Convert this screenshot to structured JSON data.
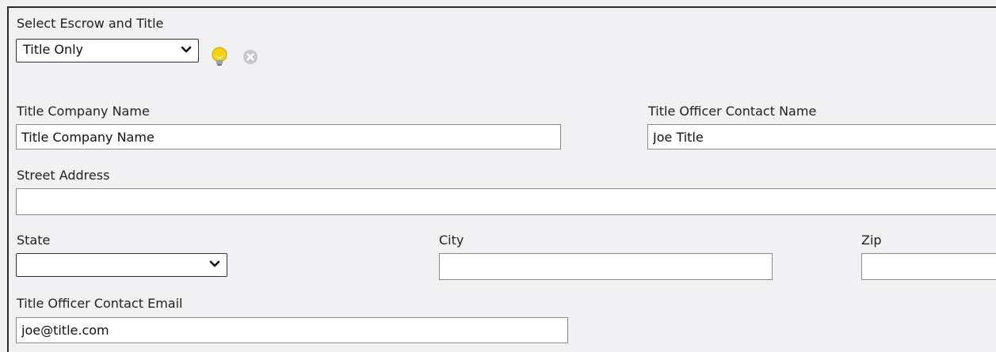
{
  "escrow": {
    "label": "Select Escrow and Title",
    "selected": "Title Only",
    "hint_icon": "lightbulb-icon",
    "clear_icon": "clear-circle-icon"
  },
  "title_company": {
    "label": "Title Company Name",
    "value": "Title Company Name"
  },
  "title_officer": {
    "label": "Title Officer Contact Name",
    "value": "Joe Title"
  },
  "street": {
    "label": "Street Address",
    "value": ""
  },
  "state": {
    "label": "State",
    "selected": ""
  },
  "city": {
    "label": "City",
    "value": ""
  },
  "zip": {
    "label": "Zip",
    "value": ""
  },
  "email": {
    "label": "Title Officer Contact Email",
    "value": "joe@title.com"
  },
  "colors": {
    "background": "#f1f1f3",
    "bulb": "#f5d20a",
    "clear_icon": "#c8c8cc"
  }
}
